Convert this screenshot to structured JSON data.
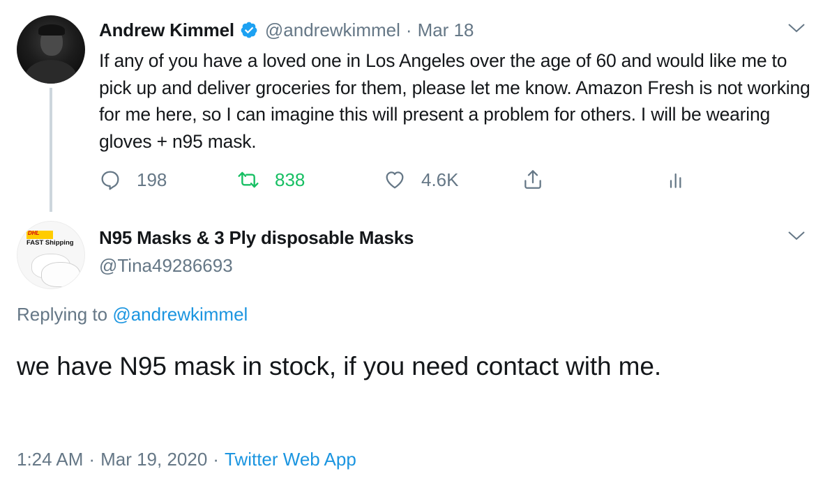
{
  "tweet1": {
    "name": "Andrew Kimmel",
    "handle": "@andrewkimmel",
    "separator": "·",
    "date": "Mar 18",
    "text": "If any of you have a loved one in Los Angeles over the age of 60 and would like me to pick up and deliver groceries for them, please let me know. Amazon Fresh is not working for me here, so I can imagine this will present a problem for others. I will be wearing gloves + n95 mask.",
    "stats": {
      "replies": "198",
      "retweets": "838",
      "likes": "4.6K"
    }
  },
  "tweet2": {
    "avatar": {
      "badge_text": "DHL",
      "caption": "FAST Shipping"
    },
    "name": "N95 Masks & 3 Ply disposable Masks",
    "handle": "@Tina49286693",
    "replying_prefix": "Replying to",
    "replying_handle": "@andrewkimmel",
    "text": "we have N95 mask in stock, if you need contact with me.",
    "time": "1:24 AM",
    "separator": "·",
    "date": "Mar 19, 2020",
    "source": "Twitter Web App"
  },
  "colors": {
    "text": "#14171a",
    "secondary": "#657786",
    "link": "#1b95e0",
    "retweet_active": "#17bf63",
    "verified": "#1da1f2",
    "thread_line": "#cdd6dd"
  },
  "icons": {
    "reply": "speech-bubble-icon",
    "retweet": "retweet-arrows-icon",
    "like": "heart-outline-icon",
    "share": "share-upload-icon",
    "stats": "bar-chart-icon",
    "more": "chevron-down-icon",
    "verified": "verified-badge-icon"
  }
}
